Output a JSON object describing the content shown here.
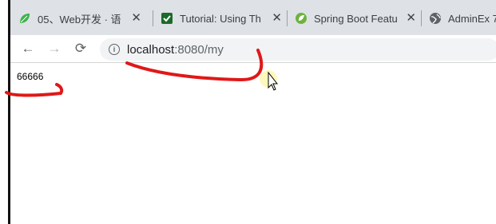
{
  "tabs": [
    {
      "title": "05、Web开发 · 语",
      "icon": "leaf-icon",
      "color": "#3bb34a"
    },
    {
      "title": "Tutorial: Using Th",
      "icon": "checkbox-icon",
      "color": "#1a6a2a"
    },
    {
      "title": "Spring Boot Featu",
      "icon": "spring-icon",
      "color": "#6db33f"
    },
    {
      "title": "AdminEx 7",
      "icon": "globe-icon",
      "color": "#5f6368"
    }
  ],
  "tab_close": "✕",
  "address_bar": {
    "host": "localhost",
    "rest": ":8080/my"
  },
  "nav": {
    "back": "←",
    "forward": "→",
    "reload": "⟳"
  },
  "page": {
    "body_text": "66666"
  },
  "annotation_color": "#e01818"
}
